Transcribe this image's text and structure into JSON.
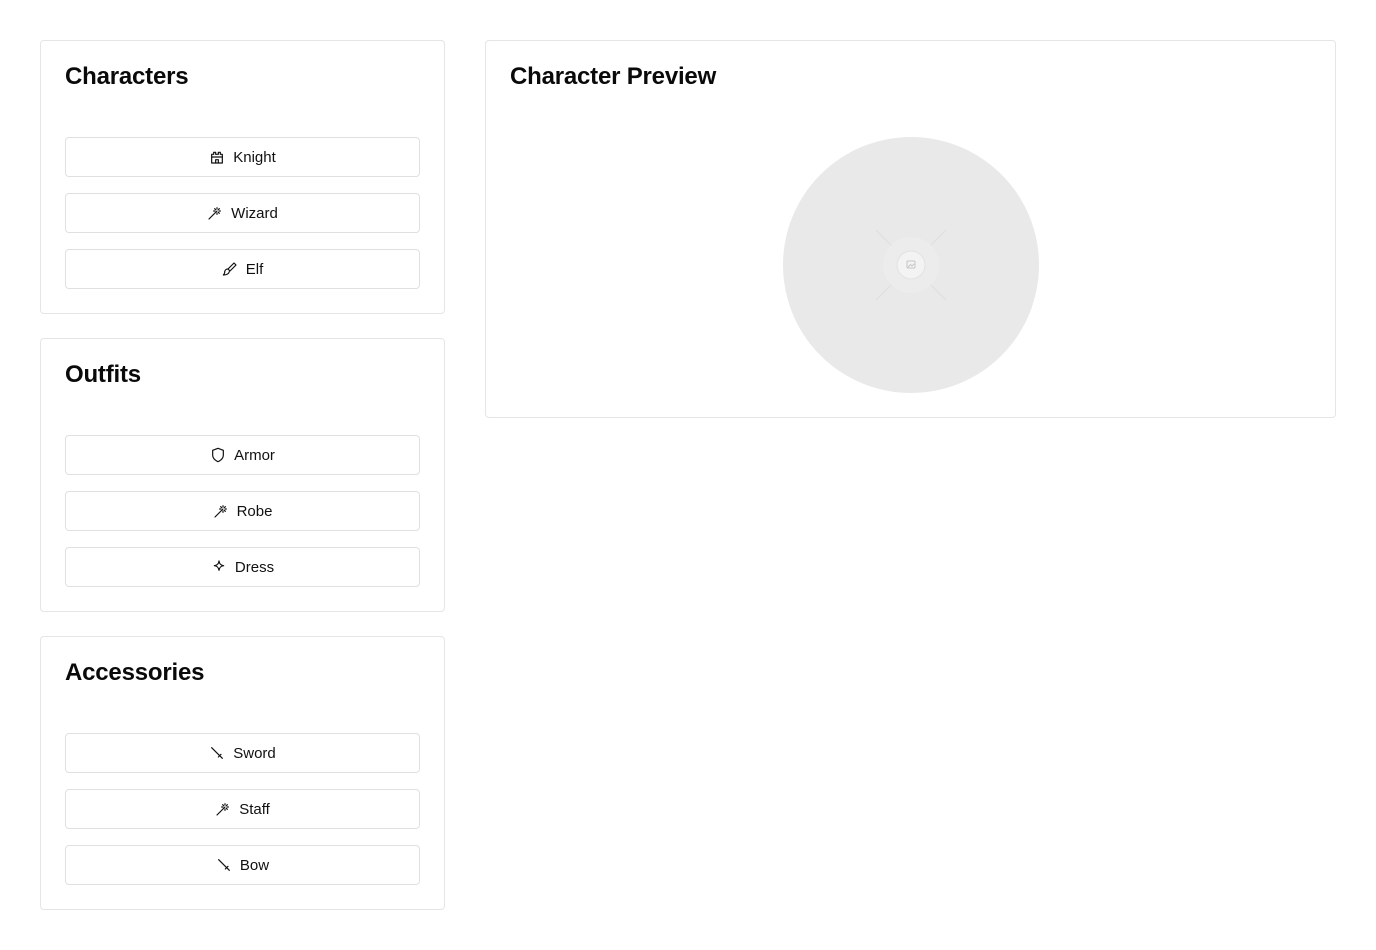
{
  "sections": {
    "characters": {
      "title": "Characters",
      "items": [
        {
          "label": "Knight",
          "icon": "castle-icon"
        },
        {
          "label": "Wizard",
          "icon": "magic-wand-icon"
        },
        {
          "label": "Elf",
          "icon": "paintbrush-icon"
        }
      ]
    },
    "outfits": {
      "title": "Outfits",
      "items": [
        {
          "label": "Armor",
          "icon": "shield-icon"
        },
        {
          "label": "Robe",
          "icon": "magic-wand-icon"
        },
        {
          "label": "Dress",
          "icon": "sparkle-icon"
        }
      ]
    },
    "accessories": {
      "title": "Accessories",
      "items": [
        {
          "label": "Sword",
          "icon": "sword-icon"
        },
        {
          "label": "Staff",
          "icon": "magic-wand-icon"
        },
        {
          "label": "Bow",
          "icon": "sword-icon"
        }
      ]
    }
  },
  "preview": {
    "title": "Character Preview",
    "image_icon": "broken-image-icon"
  },
  "colors": {
    "border": "#e5e5e5",
    "preview_bg": "#e9e9e9",
    "text": "#0a0a0a"
  }
}
